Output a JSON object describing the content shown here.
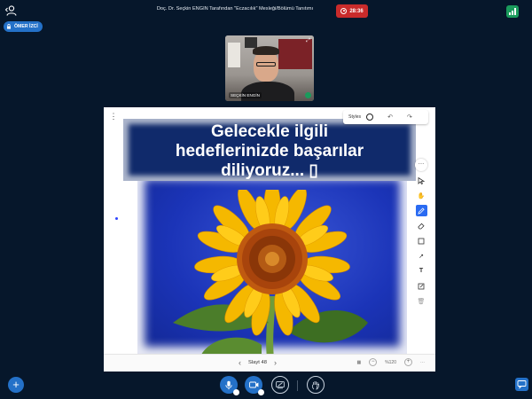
{
  "topbar": {
    "title": "Doç. Dr. Seçkin ENGİN Tarafından \"Eczacılık\" Mesleği/Bölümü Tanıtımı",
    "recording_time": "28:36"
  },
  "user_chip": {
    "name": "ÖMER İZCİ"
  },
  "webcam": {
    "label": "SEÇKİN ENGİN"
  },
  "whiteboard": {
    "styles_label": "Styles",
    "slide_title_lines": [
      "Gelecekle ilgili",
      "hedeflerinizde başarılar",
      "diliyoruz...  ▯"
    ],
    "slide_label": "Slayt 48",
    "zoom": "%120"
  },
  "icons": {
    "tools": [
      "select-icon",
      "hand-icon",
      "pencil-icon",
      "eraser-icon",
      "rectangle-icon",
      "arrow-icon",
      "text-icon",
      "note-icon",
      "trash-icon"
    ]
  },
  "colors": {
    "background": "#06172b",
    "accent": "#2471c8",
    "record": "#c92b2b",
    "connection": "#1a9b5c"
  }
}
